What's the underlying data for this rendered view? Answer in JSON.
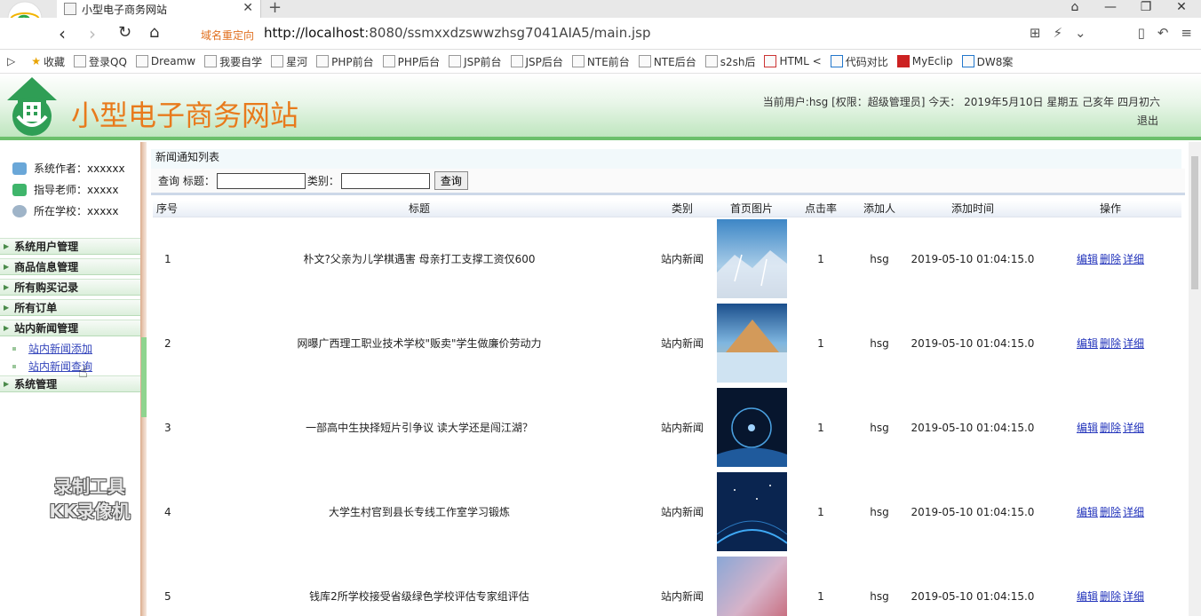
{
  "browser": {
    "tab_title": "小型电子商务网站",
    "redirect_label": "域名重定向",
    "url_host": "http://localhost",
    "url_rest": ":8080/ssmxxdzswwzhsg7041AIA5/main.jsp",
    "bookmarks": [
      "收藏",
      "登录QQ",
      "Dreamw",
      "我要自学",
      "星河",
      "PHP前台",
      "PHP后台",
      "JSP前台",
      "JSP后台",
      "NTE前台",
      "NTE后台",
      "s2sh后",
      "HTML <",
      "代码对比",
      "MyEclip",
      "DW8案"
    ]
  },
  "header": {
    "site_title": "小型电子商务网站",
    "user_info": "当前用户:hsg [权限：超级管理员] 今天： 2019年5月10日 星期五 己亥年 四月初六",
    "logout": "退出"
  },
  "sidebar": {
    "info": [
      "系统作者：xxxxxx",
      "指导老师：xxxxx",
      "所在学校：xxxxx"
    ],
    "menus": [
      "系统用户管理",
      "商品信息管理",
      "所有购买记录",
      "所有订单",
      "站内新闻管理",
      "系统管理"
    ],
    "sub_items": [
      "站内新闻添加",
      "站内新闻查询"
    ],
    "watermark_line1": "录制工具",
    "watermark_line2": "KK录像机"
  },
  "main": {
    "breadcrumb": "新闻通知列表",
    "search": {
      "prefix": "查询 标题：",
      "category_label": "类别：",
      "title_value": "",
      "category_value": "",
      "button": "查询"
    },
    "columns": [
      "序号",
      "标题",
      "类别",
      "首页图片",
      "点击率",
      "添加人",
      "添加时间",
      "操作"
    ],
    "rows": [
      {
        "no": "1",
        "title": "朴文?父亲为儿学棋遇害 母亲打工支撑工资仅600",
        "category": "站内新闻",
        "clicks": "1",
        "author": "hsg",
        "time": "2019-05-10 01:04:15.0"
      },
      {
        "no": "2",
        "title": "网曝广西理工职业技术学校\"贩卖\"学生做廉价劳动力",
        "category": "站内新闻",
        "clicks": "1",
        "author": "hsg",
        "time": "2019-05-10 01:04:15.0"
      },
      {
        "no": "3",
        "title": "一部高中生抉择短片引争议 读大学还是闯江湖？",
        "category": "站内新闻",
        "clicks": "1",
        "author": "hsg",
        "time": "2019-05-10 01:04:15.0"
      },
      {
        "no": "4",
        "title": "大学生村官到县长专线工作室学习锻炼",
        "category": "站内新闻",
        "clicks": "1",
        "author": "hsg",
        "time": "2019-05-10 01:04:15.0"
      },
      {
        "no": "5",
        "title": "钱库2所学校接受省级绿色学校评估专家组评估",
        "category": "站内新闻",
        "clicks": "1",
        "author": "hsg",
        "time": "2019-05-10 01:04:15.0"
      }
    ],
    "ops": {
      "edit": "编辑",
      "delete": "删除",
      "detail": "详细"
    }
  }
}
